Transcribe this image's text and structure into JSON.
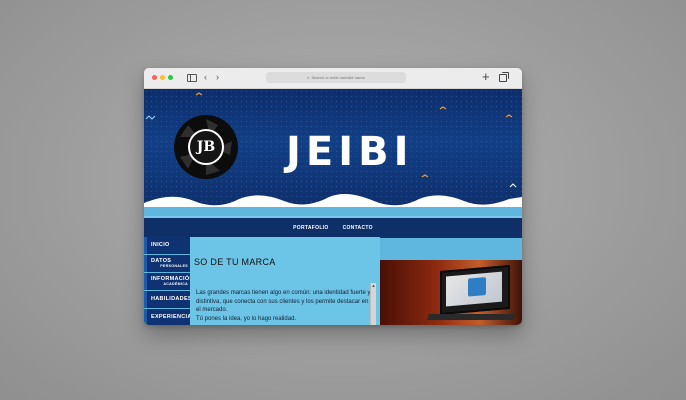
{
  "browser": {
    "url_placeholder": "Search or enter website name",
    "back_icon": "‹",
    "forward_icon": "›",
    "new_tab_icon": "+"
  },
  "hero": {
    "title": "JEIBI",
    "logo_text": "JB"
  },
  "navbar": {
    "items": [
      {
        "label": "PORTAFOLIO"
      },
      {
        "label": "CONTACTO"
      }
    ]
  },
  "sidebar": {
    "items": [
      {
        "label": "INICIO",
        "sub": ""
      },
      {
        "label": "DATOS",
        "sub": "PERSONALES"
      },
      {
        "label": "INFORMACIÓN",
        "sub": "ACADÉMICA"
      },
      {
        "label": "HABILIDADES",
        "sub": ""
      },
      {
        "label": "EXPERIENCIA",
        "sub": ""
      }
    ]
  },
  "content": {
    "heading": "SO DE TU MARCA",
    "paragraph_1": "Las grandes marcas tienen algo en común: una identidad fuerte y distintiva, que conecta con sus clientes y los permite destacar en el mercado.",
    "paragraph_2": "Tú pones la idea, yo lo hago realidad."
  },
  "colors": {
    "hero_bg": "#0d2d6a",
    "navbar_bg": "#0e2f68",
    "page_bg": "#5fb6df",
    "accent": "#f29a2e"
  }
}
